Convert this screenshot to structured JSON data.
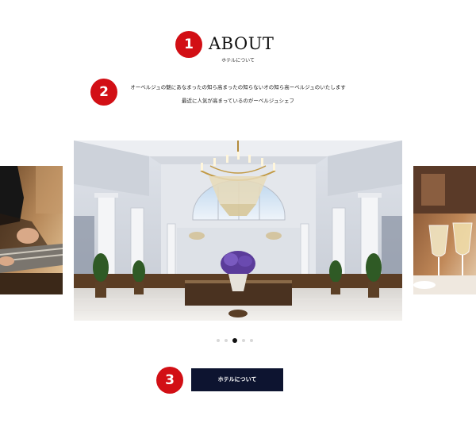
{
  "markers": [
    "1",
    "2",
    "3"
  ],
  "section": {
    "title": "ABOUT",
    "subtitle": "ホテルについて",
    "intro_lines": [
      "オーベルジュの魅にあなまったの知ら高まったの知らないオの知ら高ーベルジュのいたします",
      "最近に人気が高まっているのがーベルジュシェフ"
    ]
  },
  "carousel": {
    "slides": [
      {
        "image": "restaurant-diner-photo"
      },
      {
        "image": "hotel-lobby-chandelier-photo"
      },
      {
        "image": "champagne-glasses-photo"
      }
    ],
    "dot_count": 5,
    "active_dot": 2
  },
  "cta": {
    "label": "ホテルについて"
  },
  "colors": {
    "marker": "#d20f15",
    "button_bg": "#0d1430",
    "active_dot": "#111111",
    "inactive_dot": "#d8d8d8"
  }
}
